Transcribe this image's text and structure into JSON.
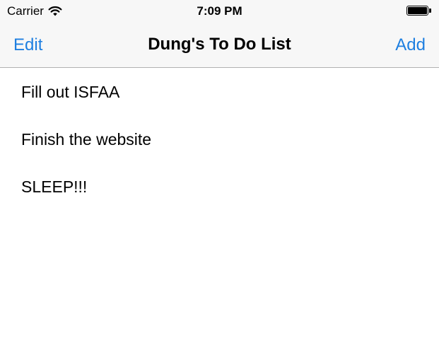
{
  "status_bar": {
    "carrier": "Carrier",
    "time": "7:09 PM",
    "battery_level": 1.0
  },
  "navbar": {
    "edit_label": "Edit",
    "title": "Dung's To Do List",
    "add_label": "Add"
  },
  "todos": [
    {
      "label": "Fill out ISFAA"
    },
    {
      "label": "Finish the website"
    },
    {
      "label": "SLEEP!!!"
    }
  ],
  "colors": {
    "accent": "#1e7fe0",
    "bar_background": "#f7f7f7",
    "separator": "#b2b2b2"
  },
  "icons": {
    "wifi": "wifi-icon",
    "battery": "battery-icon"
  }
}
